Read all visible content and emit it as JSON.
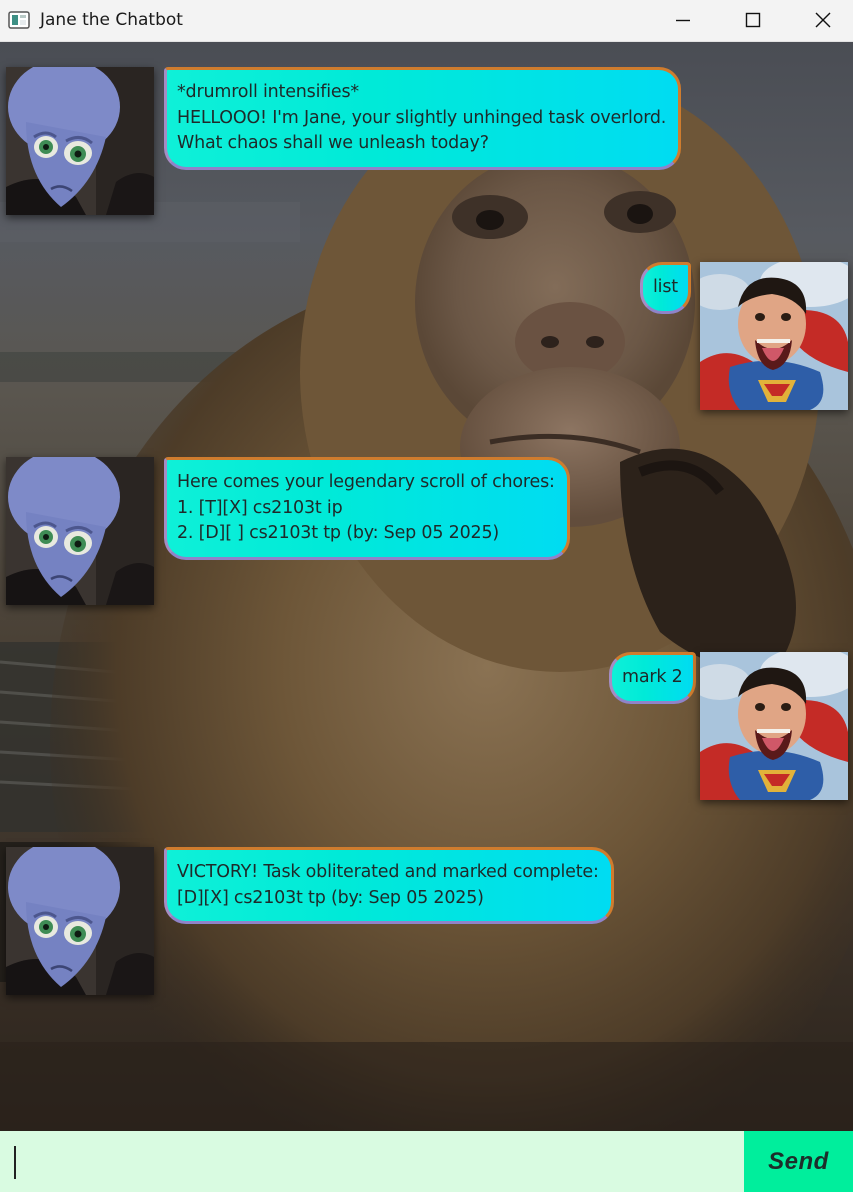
{
  "window": {
    "title": "Jane the Chatbot"
  },
  "messages": [
    {
      "sender": "bot",
      "lines": [
        "*drumroll intensifies*",
        "HELLOOO! I'm Jane, your slightly unhinged task overlord.",
        "What chaos shall we unleash today?"
      ]
    },
    {
      "sender": "user",
      "lines": [
        "list"
      ]
    },
    {
      "sender": "bot",
      "lines": [
        "Here comes your legendary scroll of chores:",
        "1. [T][X] cs2103t ip",
        "2. [D][ ] cs2103t tp (by: Sep 05 2025)"
      ]
    },
    {
      "sender": "user",
      "lines": [
        "mark 2"
      ]
    },
    {
      "sender": "bot",
      "lines": [
        "VICTORY! Task obliterated and marked complete:",
        "[D][X] cs2103t tp (by: Sep 05 2025)"
      ]
    }
  ],
  "input": {
    "value": "",
    "placeholder": ""
  },
  "send_button": {
    "label": "Send"
  },
  "colors": {
    "bubble_start": "#0ff0d8",
    "bubble_end": "#00dcf2",
    "input_bg": "#d9fbe1",
    "send_bg": "#00ee9c"
  },
  "icons": {
    "app": "app-window-icon",
    "minimize": "minimize-icon",
    "maximize": "maximize-icon",
    "close": "close-icon",
    "bot_avatar": "megamind-avatar",
    "user_avatar": "superman-avatar"
  }
}
